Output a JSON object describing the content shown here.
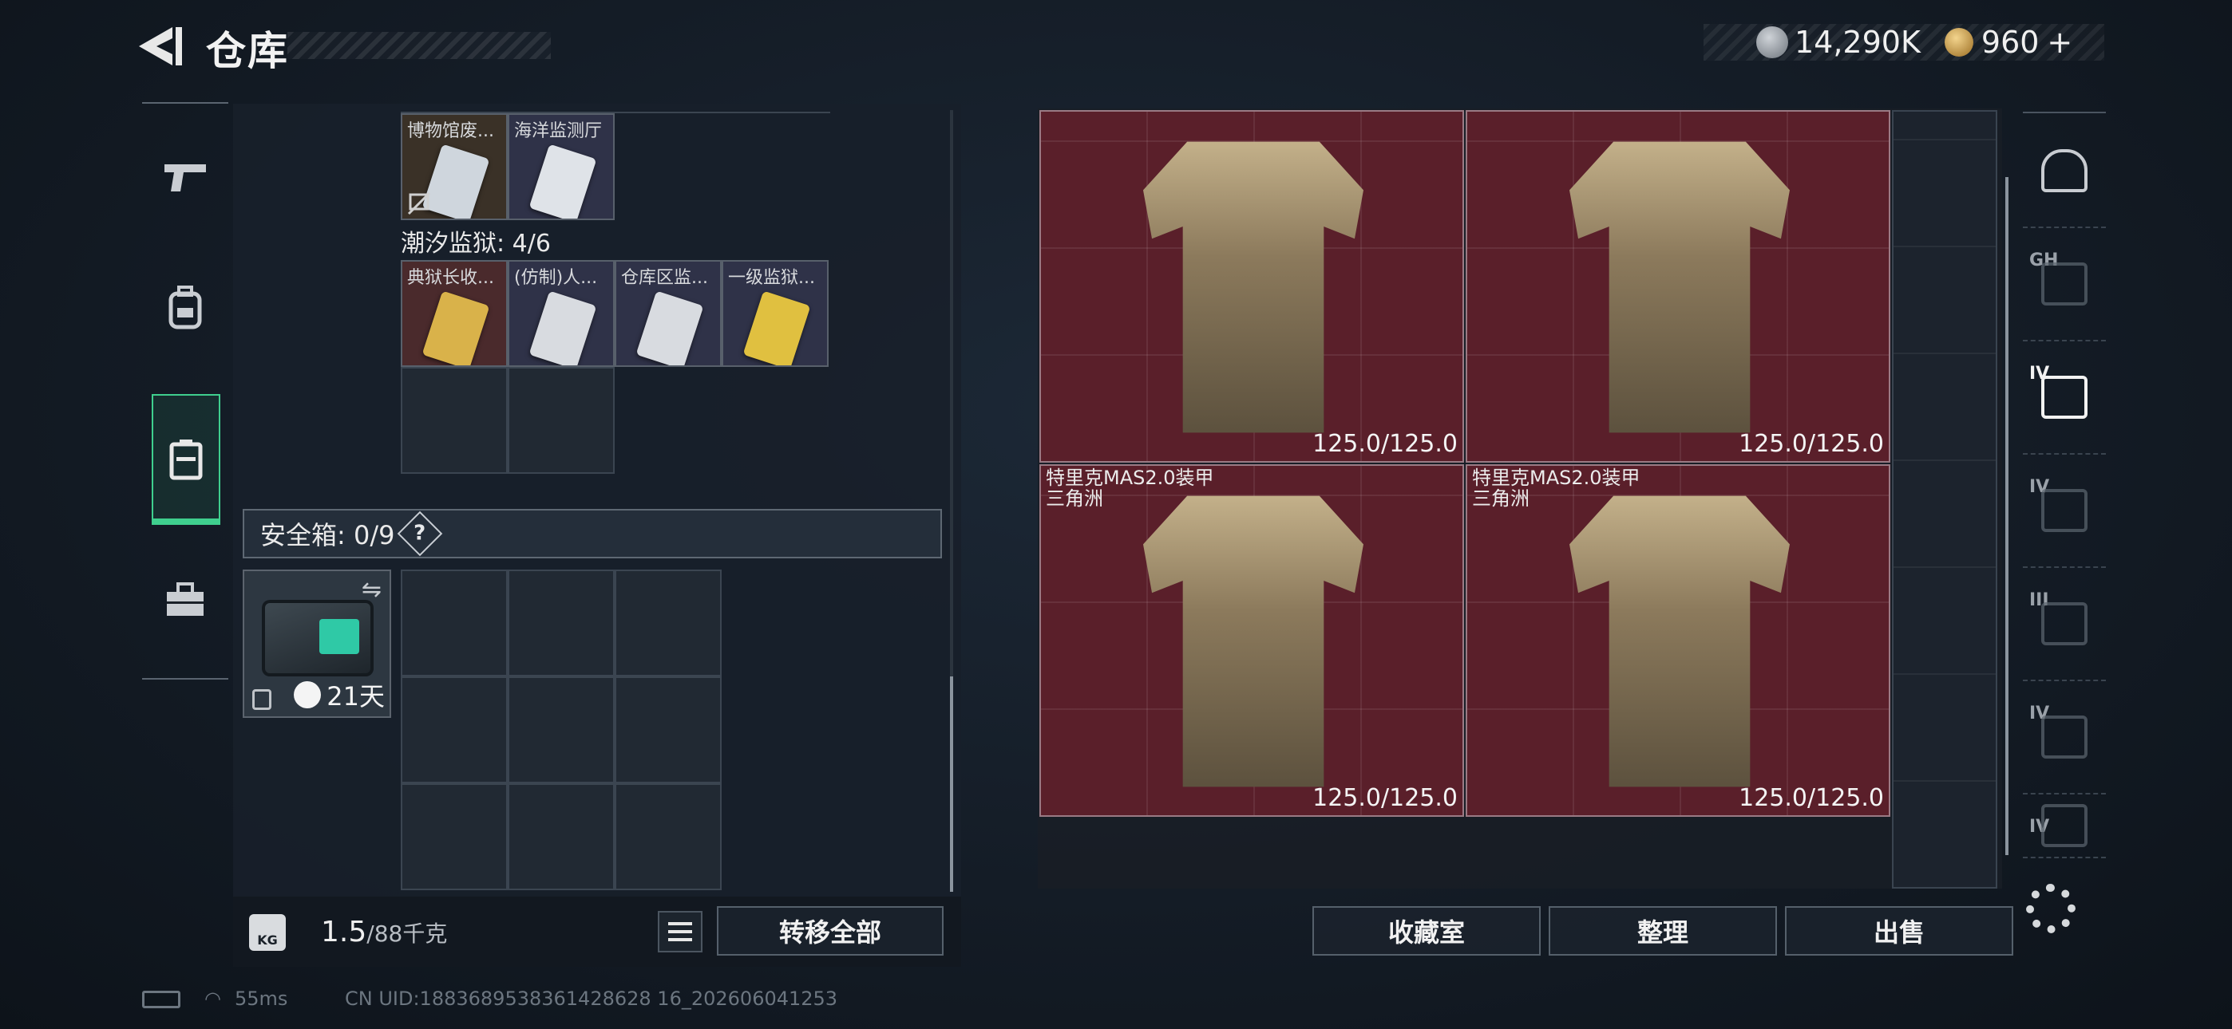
{
  "header": {
    "title": "仓库",
    "currency_silver": "14,290K",
    "currency_gold": "960",
    "currency_gold_plus": "+"
  },
  "left_nav": {
    "items": [
      {
        "icon": "pistol-icon"
      },
      {
        "icon": "backpack-icon"
      },
      {
        "icon": "container-icon",
        "active": true
      },
      {
        "icon": "toolbox-icon"
      }
    ]
  },
  "keys": {
    "row1": [
      {
        "label": "博物馆废...",
        "color": "#cfd6dd"
      },
      {
        "label": "海洋监测厅",
        "color": "#dfe3e8"
      }
    ],
    "section_title": "潮汐监狱: 4/6",
    "row2": [
      {
        "label": "典狱长收...",
        "color": "#d9b24a"
      },
      {
        "label": "(仿制)人...",
        "color": "#d8dbe0"
      },
      {
        "label": "仓库区监...",
        "color": "#d8dbe0"
      },
      {
        "label": "一级监狱...",
        "color": "#e0c040"
      }
    ]
  },
  "safe_box": {
    "label": "安全箱:  0/9",
    "help": "?",
    "days": "21天"
  },
  "weight": {
    "kg_badge": "KG",
    "current": "1.5",
    "capacity": "/88千克"
  },
  "buttons": {
    "transfer_all": "转移全部",
    "collection_room": "收藏室",
    "organize": "整理",
    "sell": "出售"
  },
  "armor_items": [
    {
      "name_line1": "",
      "name_line2": "",
      "durability": "125.0/125.0"
    },
    {
      "name_line1": "",
      "name_line2": "",
      "durability": "125.0/125.0"
    },
    {
      "name_line1": "特里克MAS2.0装甲",
      "name_line2": "三角洲",
      "durability": "125.0/125.0"
    },
    {
      "name_line1": "特里克MAS2.0装甲",
      "name_line2": "三角洲",
      "durability": "125.0/125.0"
    }
  ],
  "right_filters": [
    {
      "icon": "helmet-icon",
      "tier": ""
    },
    {
      "icon": "armor-filter-icon",
      "tier": "GH"
    },
    {
      "icon": "armor-filter-icon",
      "tier": "IV",
      "active": true
    },
    {
      "icon": "armor-filter-icon",
      "tier": "IV"
    },
    {
      "icon": "armor-filter-icon",
      "tier": "III"
    },
    {
      "icon": "folder-filter-icon",
      "tier": "IV"
    },
    {
      "icon": "folder-filter-icon",
      "tier": "IV"
    }
  ],
  "status": {
    "ping": "55ms",
    "uid": "CN UID:1883689538361428628 16_202606041253"
  }
}
